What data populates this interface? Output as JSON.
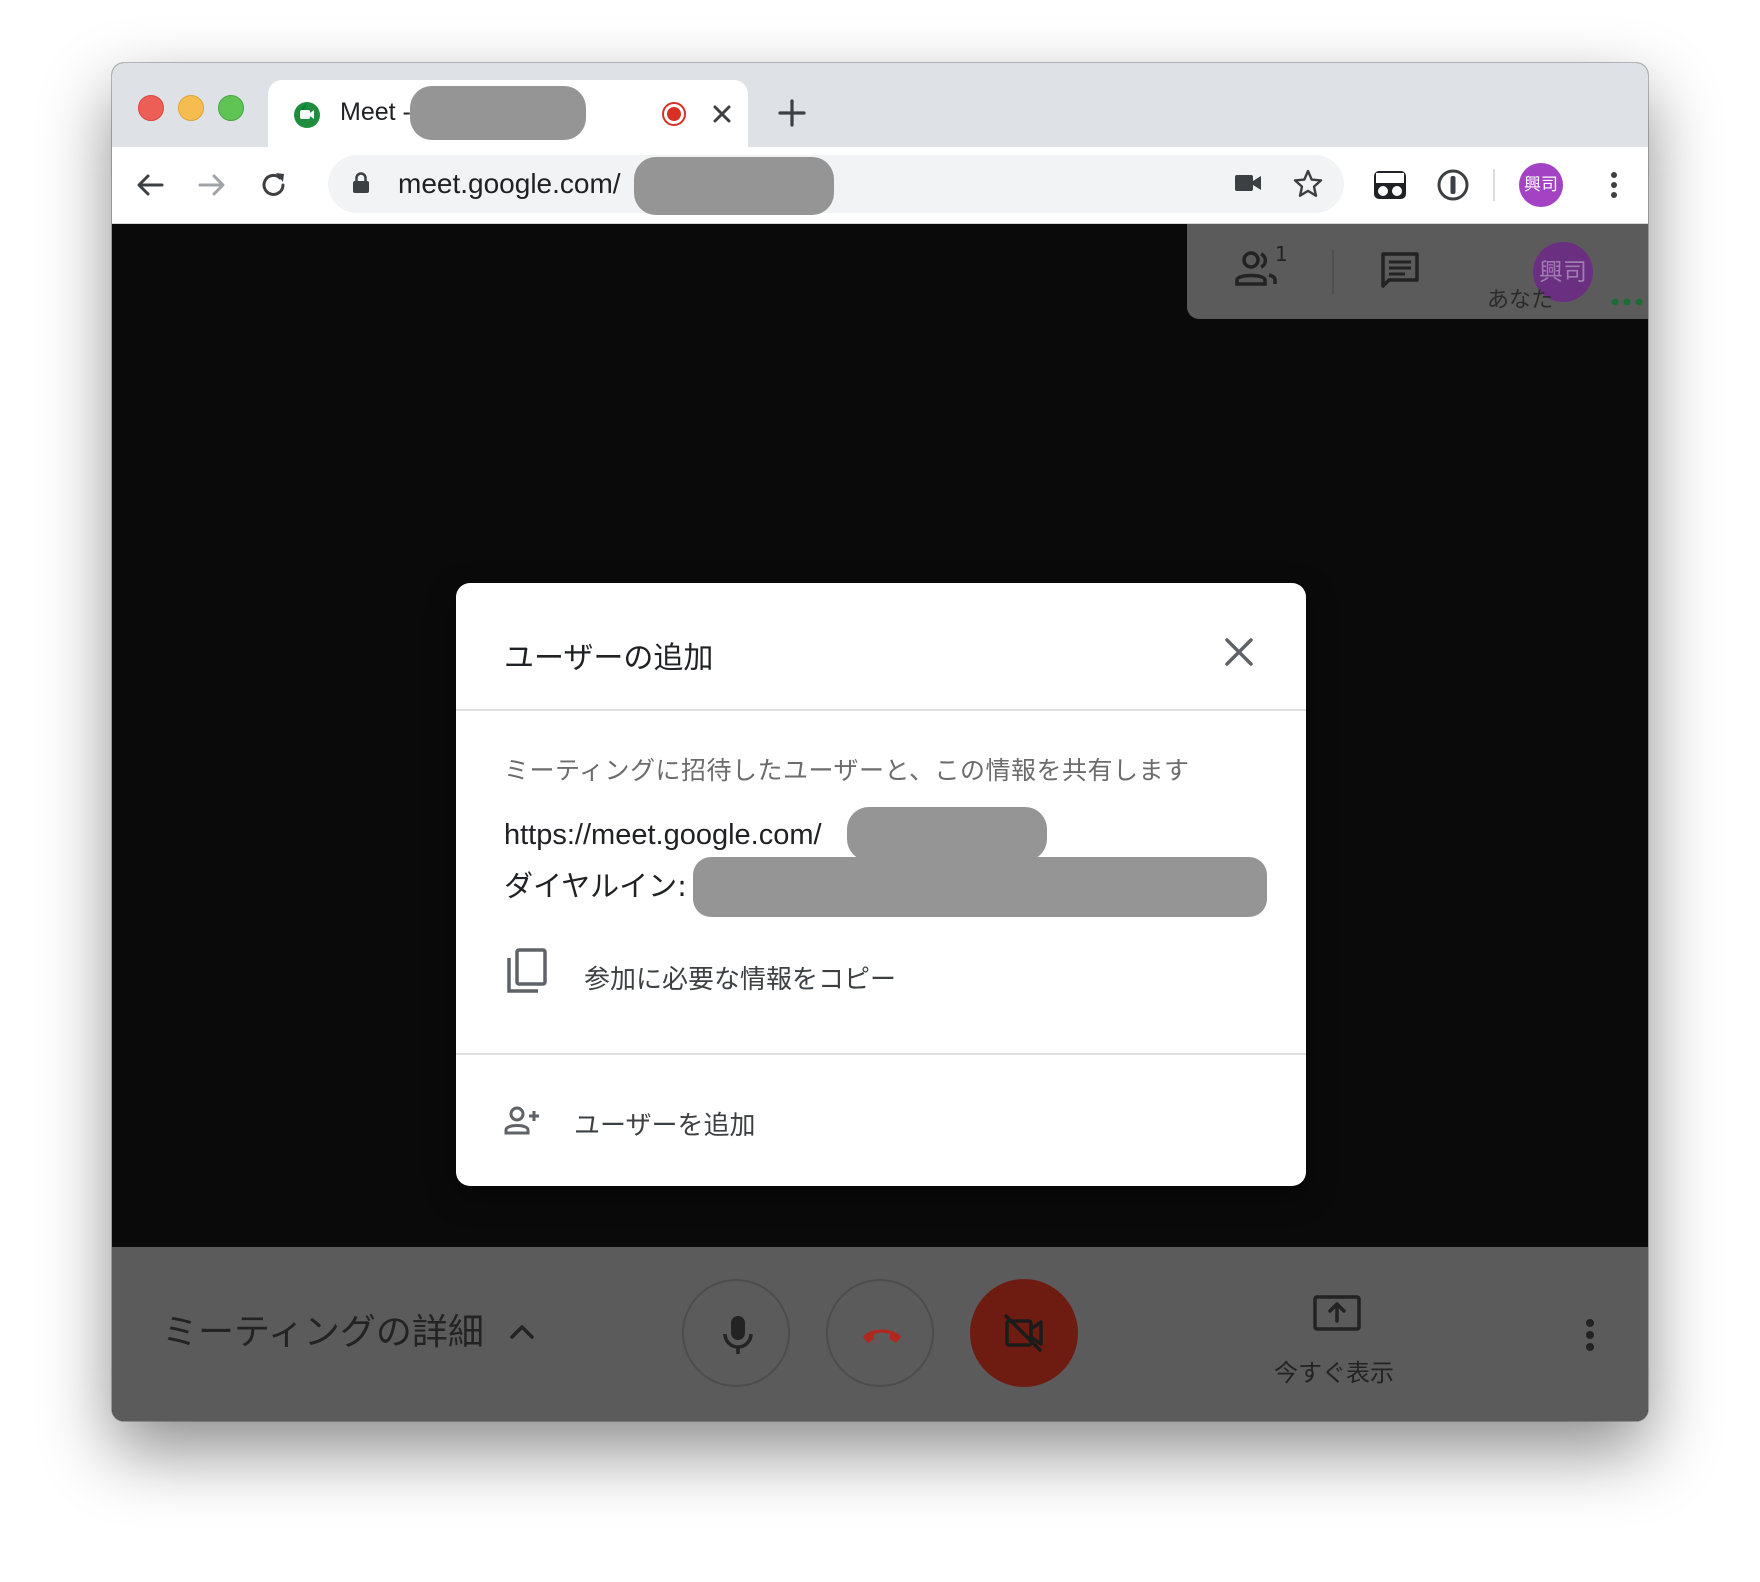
{
  "browser": {
    "tab_title": "Meet - ",
    "new_tab_symbol": "+",
    "url": "meet.google.com/",
    "profile_initials": "興司"
  },
  "meet": {
    "participant_label": "あなた",
    "participant_initials": "興司",
    "participants_count": "1",
    "meeting_details_label": "ミーティングの詳細",
    "present_now_label": "今すぐ表示"
  },
  "dialog": {
    "title": "ユーザーの追加",
    "description": "ミーティングに招待したユーザーと、この情報を共有します",
    "meeting_link": "https://meet.google.com/",
    "dial_in_label": "ダイヤルイン:",
    "copy_label": "参加に必要な情報をコピー",
    "add_user_label": "ユーザーを追加"
  },
  "colors": {
    "profile_avatar": "#a442c4",
    "record_dot": "#d93025",
    "video_off_button": "#6e1c12",
    "hangup_icon": "#b3261e"
  }
}
